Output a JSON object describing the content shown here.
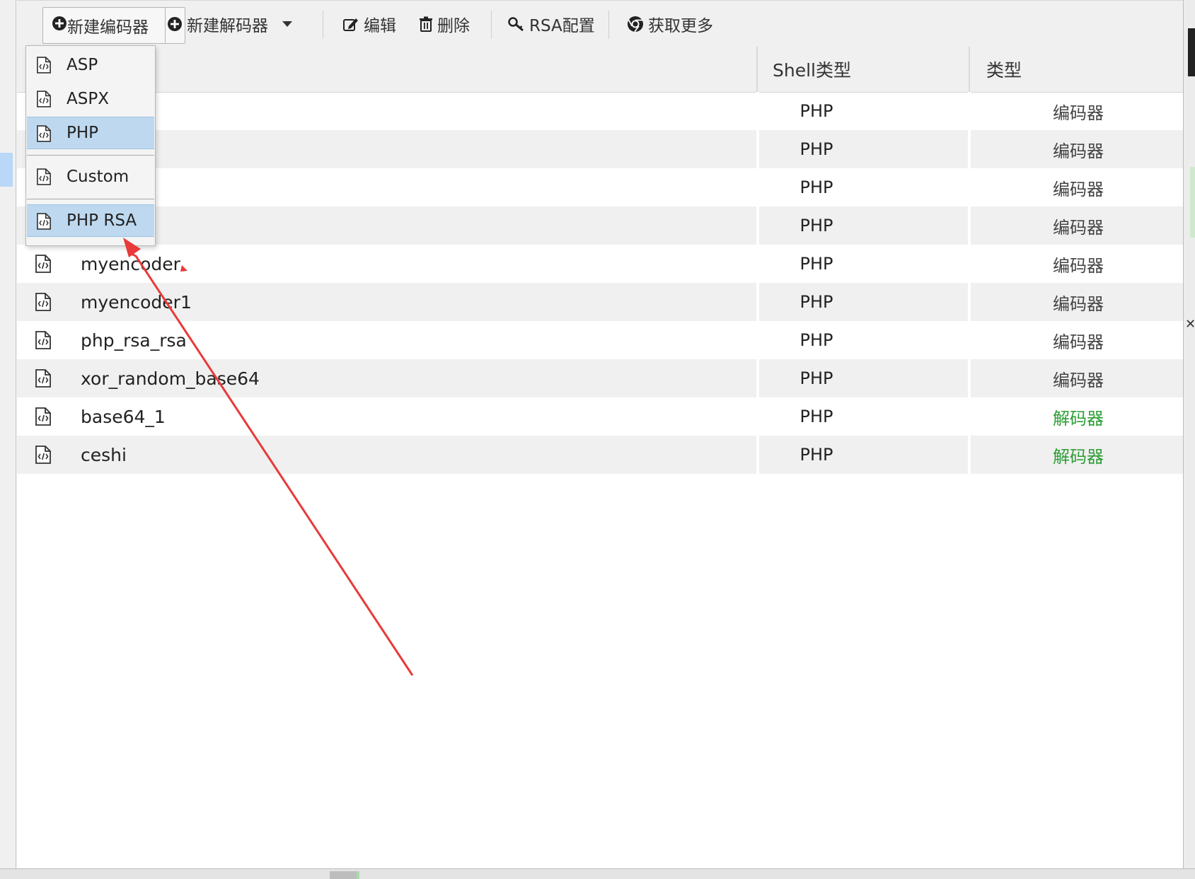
{
  "toolbar": {
    "new_encoder": "新建编码器",
    "new_decoder": "新建解码器",
    "edit": "编辑",
    "delete": "删除",
    "rsa_config": "RSA配置",
    "get_more": "获取更多"
  },
  "dropdown": {
    "items": [
      "ASP",
      "ASPX",
      "PHP",
      "Custom",
      "PHP RSA"
    ],
    "highlighted": [
      "PHP",
      "PHP RSA"
    ]
  },
  "table": {
    "headers": {
      "shell_type": "Shell类型",
      "type": "类型"
    },
    "rows": [
      {
        "name": "",
        "shell": "PHP",
        "kind": "编码器"
      },
      {
        "name": "",
        "shell": "PHP",
        "kind": "编码器"
      },
      {
        "name": "",
        "shell": "PHP",
        "kind": "编码器"
      },
      {
        "name": "",
        "shell": "PHP",
        "kind": "编码器"
      },
      {
        "name": "myencoder",
        "shell": "PHP",
        "kind": "编码器"
      },
      {
        "name": "myencoder1",
        "shell": "PHP",
        "kind": "编码器"
      },
      {
        "name": "php_rsa_rsa",
        "shell": "PHP",
        "kind": "编码器"
      },
      {
        "name": "xor_random_base64",
        "shell": "PHP",
        "kind": "编码器"
      },
      {
        "name": "base64_1",
        "shell": "PHP",
        "kind": "解码器"
      },
      {
        "name": "ceshi",
        "shell": "PHP",
        "kind": "解码器"
      }
    ]
  },
  "colors": {
    "accent_highlight": "#bed9ef",
    "decoder_text": "#2e9e35",
    "annotation_arrow": "#e83a3a"
  }
}
